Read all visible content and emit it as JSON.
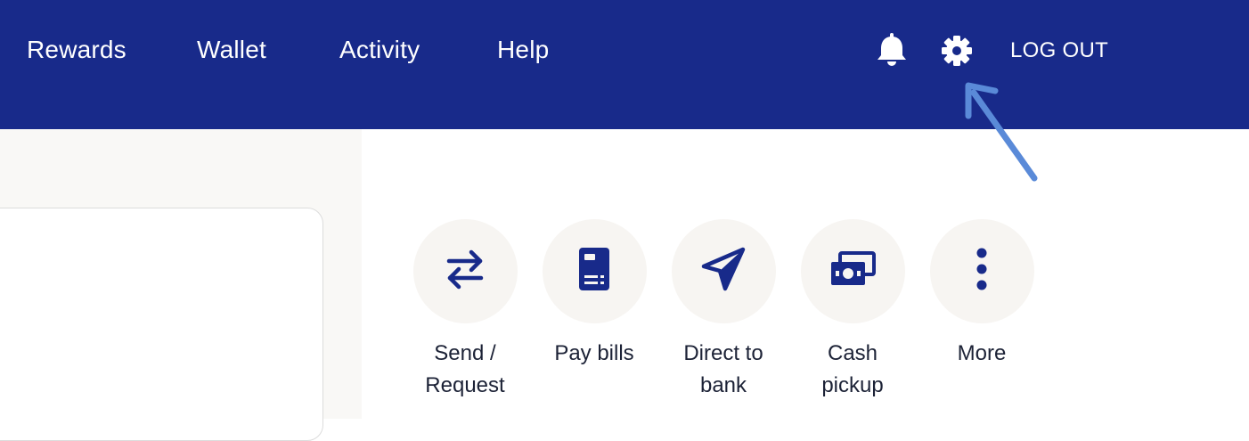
{
  "nav": {
    "items": [
      "Rewards",
      "Wallet",
      "Activity",
      "Help"
    ],
    "logout_label": "LOG OUT",
    "icons": {
      "notifications": "bell-icon",
      "settings": "gear-icon"
    }
  },
  "quick_actions": [
    {
      "label_line1": "Send /",
      "label_line2": "Request",
      "icon": "swap-arrows-icon"
    },
    {
      "label_line1": "Pay bills",
      "label_line2": "",
      "icon": "bill-icon"
    },
    {
      "label_line1": "Direct to",
      "label_line2": "bank",
      "icon": "paper-plane-icon"
    },
    {
      "label_line1": "Cash",
      "label_line2": "pickup",
      "icon": "cash-icon"
    },
    {
      "label_line1": "More",
      "label_line2": "",
      "icon": "more-vertical-icon"
    }
  ],
  "colors": {
    "header_bg": "#182a8a",
    "icon_color": "#182a8a",
    "annotation_arrow": "#5a8ad8",
    "circle_bg": "#f7f5f2"
  }
}
